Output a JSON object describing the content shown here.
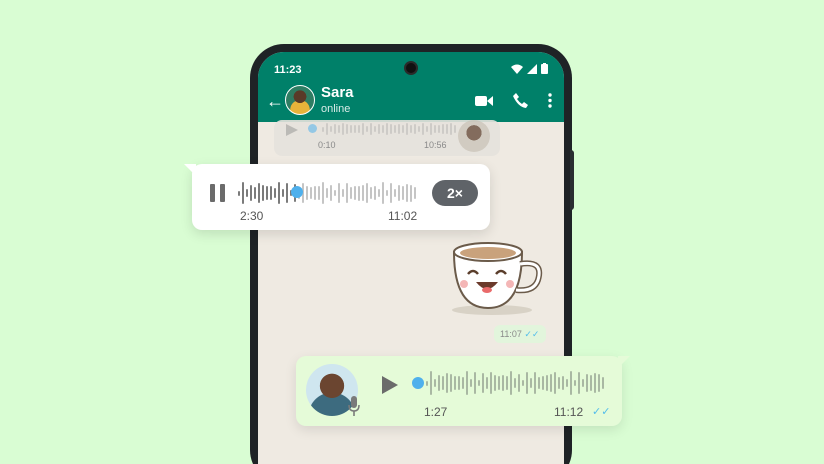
{
  "status_bar": {
    "time": "11:23"
  },
  "header": {
    "back_icon": "back-arrow-icon",
    "contact_name": "Sara",
    "contact_status": "online"
  },
  "faint_message": {
    "duration": "0:10",
    "time": "10:56"
  },
  "voice_message_sent": {
    "duration": "2:30",
    "time": "11:02",
    "speed": "2×",
    "progress": 0.33
  },
  "sticker_message": {
    "time": "11:07"
  },
  "voice_message_received": {
    "duration": "1:27",
    "time": "11:12",
    "progress": 0.0
  },
  "colors": {
    "header": "#008069",
    "background": "#d9fdd3",
    "accent_dot": "#4fb0ec",
    "read_ticks": "#53bdeb"
  }
}
